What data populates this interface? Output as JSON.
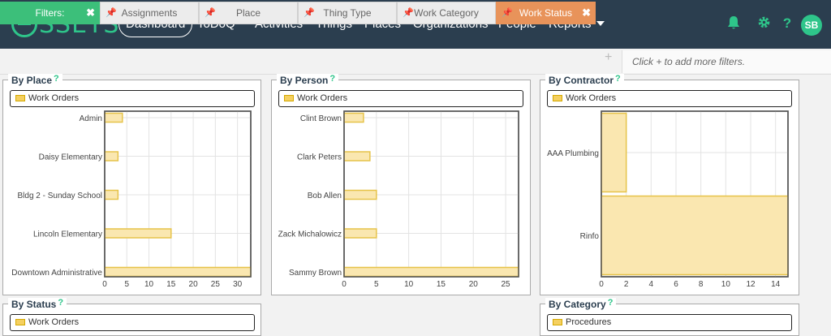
{
  "app": {
    "logo_text": "SSETS"
  },
  "nav": {
    "items": [
      {
        "label": "Dashboard"
      },
      {
        "label": "ToDoQ™"
      },
      {
        "label": "Activities"
      },
      {
        "label": "Things"
      },
      {
        "label": "Places"
      },
      {
        "label": "Organizations"
      },
      {
        "label": "People"
      },
      {
        "label": "Reports"
      }
    ],
    "help_glyph": "?",
    "avatar_initials": "SB"
  },
  "filters": {
    "label": "Filters:",
    "chips": [
      "Assignments",
      "Place",
      "Thing Type",
      "Work Category",
      "Work Status"
    ],
    "hint": "Click + to add more filters."
  },
  "panels": {
    "by_place": {
      "title": "By Place",
      "legend": "Work Orders"
    },
    "by_person": {
      "title": "By Person",
      "legend": "Work Orders"
    },
    "by_contractor": {
      "title": "By Contractor",
      "legend": "Work Orders"
    },
    "by_status": {
      "title": "By Status",
      "legend": "Work Orders"
    },
    "by_category": {
      "title": "By Category",
      "legend": "Procedures"
    }
  },
  "colors": {
    "accent": "#2ec58a",
    "nav_bg": "#2b3e4f",
    "bar_fill": "#fae7b0",
    "bar_stroke": "#e6c34a",
    "status_chip": "#e8935a",
    "filters_chip": "#3cbf7a"
  },
  "chart_data": [
    {
      "type": "bar",
      "orientation": "horizontal",
      "categories": [
        "Admin",
        "Daisy Elementary",
        "Bldg 2 - Sunday School",
        "Lincoln Elementary",
        "Downtown Administrative"
      ],
      "values": [
        4,
        3,
        3,
        15,
        33
      ],
      "xlim": [
        0,
        33
      ],
      "xticks": [
        0,
        5,
        10,
        15,
        20,
        25,
        30
      ],
      "grid": true
    },
    {
      "type": "bar",
      "orientation": "horizontal",
      "categories": [
        "Clint Brown",
        "Clark Peters",
        "Bob Allen",
        "Zack Michalowicz",
        "Sammy Brown"
      ],
      "values": [
        3,
        4,
        5,
        5,
        27
      ],
      "xlim": [
        0,
        27
      ],
      "xticks": [
        0,
        5,
        10,
        15,
        20,
        25
      ],
      "grid": true
    },
    {
      "type": "bar",
      "orientation": "horizontal",
      "categories": [
        "AAA Plumbing",
        "Rinfo"
      ],
      "values": [
        2,
        15
      ],
      "xlim": [
        0,
        15
      ],
      "xticks": [
        0,
        2,
        4,
        6,
        8,
        10,
        12,
        14
      ],
      "grid": true
    }
  ]
}
